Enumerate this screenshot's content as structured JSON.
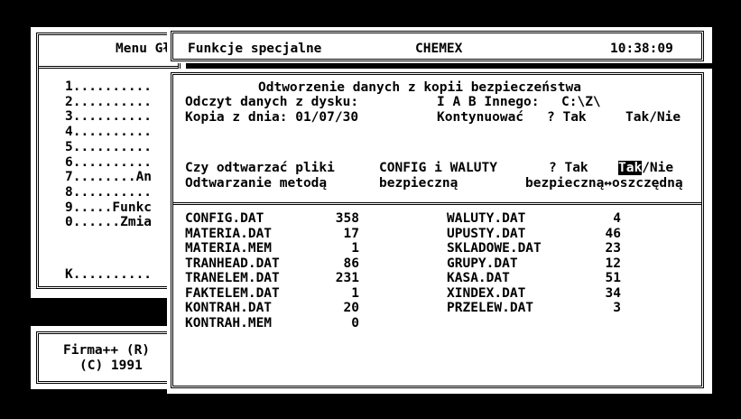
{
  "menu": {
    "title": "Menu Głó",
    "items": [
      "1..........",
      "2..........",
      "3..........",
      "4..........",
      "5..........",
      "6..........",
      "7........An",
      "8..........",
      "9.....Funkc",
      "0......Zmia"
    ],
    "k_item": "K.........."
  },
  "firm": {
    "line1": "Firma++ (R)",
    "line2": "(C) 1991"
  },
  "header": {
    "section": "Funkcje specjalne",
    "app": "CHEMEX",
    "clock": "10:38:09"
  },
  "dialog": {
    "title": "Odtworzenie danych z kopii bezpieczeństwa",
    "read_label": "Odczyt danych z dysku:",
    "read_options": "I A B Innego:",
    "read_path": "C:\\Z\\",
    "copy_date_label": "Kopia z dnia: 01/07/30",
    "continue_label": "Kontynuować",
    "continue_value": "? Tak",
    "continue_options": "Tak/Nie",
    "restore_label": "Czy odtwarzać pliki",
    "restore_files": "CONFIG i WALUTY",
    "restore_value": "? Tak",
    "restore_opt_selected": "Tak",
    "restore_opt_rest": "/Nie",
    "method_label": "Odtwarzanie metodą",
    "method_value": "bezpieczną",
    "method_options": "bezpieczną↔oszczędną"
  },
  "files_left": [
    {
      "name": "CONFIG.DAT",
      "count": "358"
    },
    {
      "name": "MATERIA.DAT",
      "count": "17"
    },
    {
      "name": "MATERIA.MEM",
      "count": "1"
    },
    {
      "name": "TRANHEAD.DAT",
      "count": "86"
    },
    {
      "name": "TRANELEM.DAT",
      "count": "231"
    },
    {
      "name": "FAKTELEM.DAT",
      "count": "1"
    },
    {
      "name": "KONTRAH.DAT",
      "count": "20"
    },
    {
      "name": "KONTRAH.MEM",
      "count": "0"
    }
  ],
  "files_right": [
    {
      "name": "WALUTY.DAT",
      "count": "4"
    },
    {
      "name": "UPUSTY.DAT",
      "count": "46"
    },
    {
      "name": "SKLADOWE.DAT",
      "count": "23"
    },
    {
      "name": "GRUPY.DAT",
      "count": "12"
    },
    {
      "name": "KASA.DAT",
      "count": "51"
    },
    {
      "name": "XINDEX.DAT",
      "count": "34"
    },
    {
      "name": "PRZELEW.DAT",
      "count": "3"
    }
  ]
}
